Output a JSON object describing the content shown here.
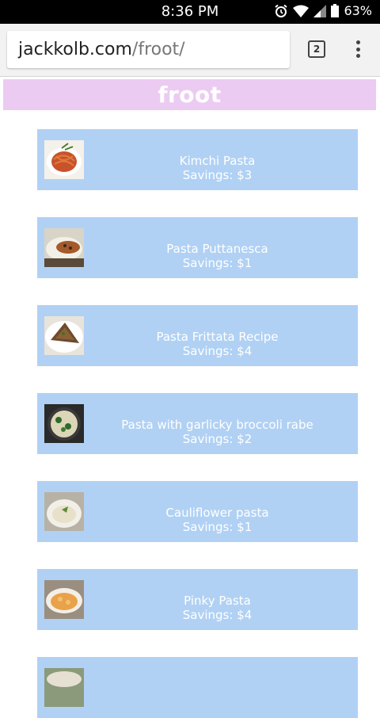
{
  "status_bar": {
    "time": "8:36 PM",
    "battery": "63%"
  },
  "browser": {
    "url_host": "jackkolb.com",
    "url_path": "/froot/",
    "tab_count": "2"
  },
  "app": {
    "title": "froot"
  },
  "recipes": [
    {
      "name": "Kimchi Pasta",
      "savings": "Savings: $3"
    },
    {
      "name": "Pasta Puttanesca",
      "savings": "Savings: $1"
    },
    {
      "name": "Pasta Frittata Recipe",
      "savings": "Savings: $4"
    },
    {
      "name": "Pasta with garlicky broccoli rabe",
      "savings": "Savings: $2"
    },
    {
      "name": "Cauliflower pasta",
      "savings": "Savings: $1"
    },
    {
      "name": "Pinky Pasta",
      "savings": "Savings: $4"
    },
    {
      "name": "",
      "savings": ""
    }
  ],
  "colors": {
    "header": "#eccbf2",
    "card": "#b0d1f4",
    "status_bar": "#000000"
  }
}
